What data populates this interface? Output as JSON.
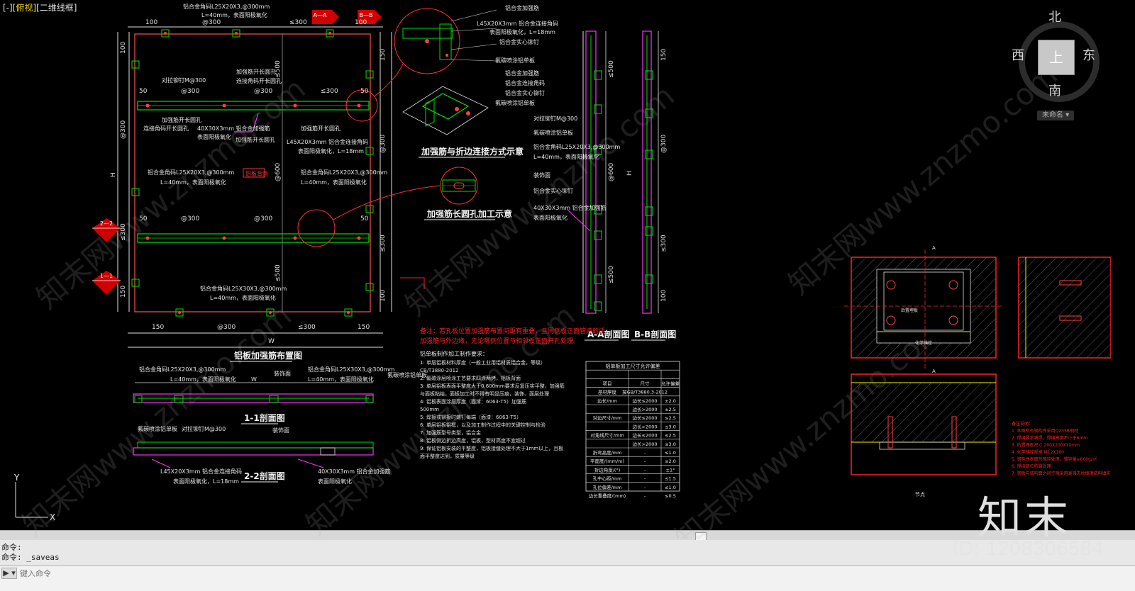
{
  "viewport": {
    "prefix": "[-][",
    "view": "俯视",
    "mid": "][",
    "style": "二维线框",
    "suffix": "]"
  },
  "compass": {
    "north": "北",
    "south": "南",
    "east": "东",
    "west": "西",
    "face": "上",
    "wcs": "未命名"
  },
  "command": {
    "history": [
      "命令:",
      "命令:  _saveas"
    ],
    "placeholder": "键入命令",
    "prompt_icon": "▶ ▾"
  },
  "ucs": {
    "y": "Y",
    "x": "X"
  },
  "watermark_text": "知末网www.znzmo.com",
  "logo": "知末",
  "id_label": "ID: 1208306584",
  "drawing": {
    "plan": {
      "title": "铝板加强筋布置图",
      "top_dims": [
        "100",
        "@300",
        "≤300",
        "100"
      ],
      "bottom_dims": [
        "150",
        "@300",
        "≤300",
        "150"
      ],
      "left_dims": [
        "100",
        "@300",
        "≤300",
        "150"
      ],
      "right_dims": [
        "150",
        "@300",
        "≤300",
        "100"
      ],
      "width_symbol": "W",
      "height_symbol": "H",
      "inner_dims": [
        "≤500",
        "@600",
        "≤500"
      ],
      "rib_dims": [
        "50",
        "@300",
        "@300",
        "≤300",
        "50"
      ],
      "rib_dims2": [
        "50",
        "@300",
        "@300",
        "50"
      ],
      "notes": {
        "top_angle": "铝合金角码L25X20X3,@300mm",
        "top_angle2": "L=40mm，表面阳极氧化",
        "rib_bolt": "对拉铆钉M@300",
        "rib_hole": "加强筋开长圆孔",
        "rib_conn": "连接角码开长圆孔",
        "rib_hole2": "加强筋开长圆孔",
        "rib_hole3": "加强筋开长圆孔",
        "rib_bar": "40X30X3mm 铝合金加强筋",
        "rib_bar2": "表面阳极氧化",
        "conn_angle": "L45X20X3mm 铝合金连接角码",
        "conn_angle2": "表面阳极氧化，L=18mm",
        "side_angle": "铝合金角码L25X20X3,@300mm",
        "side_angle2": "L=40mm，表面阳极氧化",
        "side_angle3": "铝合金角码L25X20X3,@300mm",
        "side_angle4": "L=40mm，表面阳极氧化",
        "center_tag": "铝板背面",
        "bottom_angle": "铝合金角码L25X30X3,@300mm",
        "bottom_angle2": "L=40mm，表面阳极氧化"
      },
      "markers": [
        {
          "id": "A-A",
          "label": "A—A"
        },
        {
          "id": "B-B",
          "label": "B—B"
        },
        {
          "id": "2-2",
          "label": "2—2"
        },
        {
          "id": "1-1",
          "label": "1—1"
        }
      ]
    },
    "detail": {
      "title1": "加强筋与折边连接方式示意",
      "title2": "加强筋长圆孔加工示意",
      "labels": [
        "铝合金加强筋",
        "L45X20X3mm 铝合金连接角码",
        "表面阳极氧化，L=18mm",
        "铝合金实心铆钉",
        "氟碳喷涂铝单板",
        "铝合金加强筋",
        "铝合金连接角码",
        "铝合金实心铆钉",
        "氟碳喷涂铝单板"
      ]
    },
    "sections": {
      "s11_title": "1-1剖面图",
      "s22_title": "2-2剖面图",
      "aa_title": "A-A剖面图",
      "bb_title": "B-B剖面图",
      "s11_notes": [
        "铝合金角码L25X20X3,@300mm",
        "L=40mm，表面阳极氧化",
        "装饰面",
        "铝合金角码L25X30X3,@300mm",
        "L=40mm，表面阳极氧化",
        "氟碳喷涂铝单板"
      ],
      "s22_notes": [
        "氟碳喷涂铝单板",
        "对拉铆钉M@300",
        "装饰面",
        "L45X20X3mm 铝合金连接角码",
        "表面阳极氧化，L=18mm",
        "40X30X3mm 铝合金加强筋",
        "表面阳极氧化"
      ],
      "aa_notes": [
        "对拉铆钉M@300",
        "氟碳喷涂铝单板",
        "铝合金角码L25X20X3,@300mm",
        "L=40mm，表面阳极氧化",
        "装饰面",
        "铝合金实心铆钉",
        "40X30X3mm 铝合金加强筋",
        "表面阳极氧化"
      ],
      "aa_dims": [
        "≤500",
        "@600",
        "≤500"
      ],
      "bb_dims": [
        "150",
        "@300",
        "≤300",
        "100"
      ],
      "height_symbol": "H"
    },
    "spec_notes": {
      "red_note1": "备注：若孔板位置加强筋布置间距有重叠，且同侧板正面管道的话",
      "red_note2": "加强筋与外边缘，无论哪侧位置与相邻板正面开孔处理。",
      "heading": "铝单板制作加工制作要求：",
      "items": [
        "1: 单层铝板材料厚度（一般工业用铝材质铝合金，等级）",
        "CB/T3880-2012",
        "2: 氟碳涂层喷涂工艺要求四涂两烤，铝板背面",
        "3: 单层铝板表面平整度大于0.600mm要求反复压实平整，加强筋",
        "与面板粘结，面板加工时不得有明显压痕，装饰、面层处理",
        "4: 铝板表面涂层厚度（面漆：6063-T5）加强筋",
        "500mm",
        "5: 焊接或铆接时螺钉每端（面漆：6063-T5）",
        "6: 单层铝板铝框，以及加工制作过程中的关键控制与检验",
        "7: 加强筋型号类型，铝合金",
        "8: 铝板侧边折边高度，铝板，型材高度不宜超过",
        "9: 保证铝板安装的平整度，铝板接缝处理不大于1mm以上，且板",
        "面平整度达到，质量等级"
      ]
    },
    "table": {
      "title": "铝单板加工尺寸允许偏差",
      "headers": [
        "项目",
        "尺寸",
        "允许偏差"
      ],
      "rows": [
        [
          "基材厚度",
          "按GB/T3880.3-2012",
          ""
        ],
        [
          "边长/mm",
          "边长≤2000",
          "±2.0"
        ],
        [
          "",
          "边长>2000",
          "±2.5"
        ],
        [
          "对边尺寸/mm",
          "边长≤2000",
          "≤2.5"
        ],
        [
          "",
          "边长>2000",
          "≤3.0"
        ],
        [
          "对角线尺寸/mm",
          "边长≤2000",
          "≤2.5"
        ],
        [
          "",
          "边长>2000",
          "≤3.0"
        ],
        [
          "折弯高度/mm",
          "-",
          "≤1.0"
        ],
        [
          "平面度/(mm/m)",
          "-",
          "≤2.0"
        ],
        [
          "折边角度/(°)",
          "-",
          "±1°"
        ],
        [
          "孔中心距/mm",
          "-",
          "≤1.5"
        ],
        [
          "孔位偏差/mm",
          "-",
          "≤1.0"
        ],
        [
          "边长重叠度/(mm)",
          "-",
          "≤0.5"
        ]
      ]
    },
    "right_details": {
      "axis_a": "A",
      "caption": "节点",
      "notes": [
        "备注说明：",
        "1. 本图所有钢构件采用Q235B钢材",
        "2. 焊缝要求满焊，焊缝高度不小于6mm",
        "3. 后置埋板尺寸 200X200X10mm",
        "4. 化学锚栓规格 M12X160",
        "5. 钢构件表面热镀锌处理，镀锌量≥600g/㎡",
        "6. 焊接部位防腐处理",
        "7. 钢板与结构面之间空隙采用高强无收缩灌浆料填实"
      ],
      "label_plate": "后置埋板",
      "label_bolt": "化学锚栓"
    }
  }
}
